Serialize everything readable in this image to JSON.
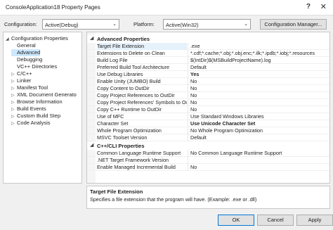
{
  "window": {
    "title": "ConsoleApplication18 Property Pages",
    "help_glyph": "?",
    "close_glyph": "✕"
  },
  "config_bar": {
    "configuration_label": "Configuration:",
    "configuration_value": "Active(Debug)",
    "platform_label": "Platform:",
    "platform_value": "Active(Win32)",
    "config_manager_label": "Configuration Manager..."
  },
  "tree": {
    "items": [
      {
        "label": "Configuration Properties",
        "arrow": "◢",
        "indent": 0,
        "selected": false
      },
      {
        "label": "General",
        "arrow": "",
        "indent": 1,
        "selected": false
      },
      {
        "label": "Advanced",
        "arrow": "",
        "indent": 1,
        "selected": true
      },
      {
        "label": "Debugging",
        "arrow": "",
        "indent": 1,
        "selected": false
      },
      {
        "label": "VC++ Directories",
        "arrow": "",
        "indent": 1,
        "selected": false
      },
      {
        "label": "C/C++",
        "arrow": "▷",
        "indent": 1,
        "selected": false
      },
      {
        "label": "Linker",
        "arrow": "▷",
        "indent": 1,
        "selected": false
      },
      {
        "label": "Manifest Tool",
        "arrow": "▷",
        "indent": 1,
        "selected": false
      },
      {
        "label": "XML Document Generato",
        "arrow": "▷",
        "indent": 1,
        "selected": false
      },
      {
        "label": "Browse Information",
        "arrow": "▷",
        "indent": 1,
        "selected": false
      },
      {
        "label": "Build Events",
        "arrow": "▷",
        "indent": 1,
        "selected": false
      },
      {
        "label": "Custom Build Step",
        "arrow": "▷",
        "indent": 1,
        "selected": false
      },
      {
        "label": "Code Analysis",
        "arrow": "▷",
        "indent": 1,
        "selected": false
      }
    ]
  },
  "grid": {
    "sections": [
      {
        "name": "Advanced Properties",
        "toggle": "◢",
        "rows": [
          {
            "name": "Target File Extension",
            "value": ".exe",
            "bold": false,
            "selected": true
          },
          {
            "name": "Extensions to Delete on Clean",
            "value": "*.cdf;*.cache;*.obj;*.obj.enc;*.ilk;*.ipdb;*.iobj;*.resources",
            "bold": false,
            "selected": false
          },
          {
            "name": "Build Log File",
            "value": "$(IntDir)$(MSBuildProjectName).log",
            "bold": false,
            "selected": false
          },
          {
            "name": "Preferred Build Tool Architecture",
            "value": "Default",
            "bold": false,
            "selected": false
          },
          {
            "name": "Use Debug Libraries",
            "value": "Yes",
            "bold": true,
            "selected": false
          },
          {
            "name": "Enable Unity (JUMBO) Build",
            "value": "No",
            "bold": false,
            "selected": false
          },
          {
            "name": "Copy Content to OutDir",
            "value": "No",
            "bold": false,
            "selected": false
          },
          {
            "name": "Copy Project References to OutDir",
            "value": "No",
            "bold": false,
            "selected": false
          },
          {
            "name": "Copy Project References' Symbols to Ou",
            "value": "No",
            "bold": false,
            "selected": false
          },
          {
            "name": "Copy C++ Runtime to OutDir",
            "value": "No",
            "bold": false,
            "selected": false
          },
          {
            "name": "Use of MFC",
            "value": "Use Standard Windows Libraries",
            "bold": false,
            "selected": false
          },
          {
            "name": "Character Set",
            "value": "Use Unicode Character Set",
            "bold": true,
            "selected": false
          },
          {
            "name": "Whole Program Optimization",
            "value": "No Whole Program Optimization",
            "bold": false,
            "selected": false
          },
          {
            "name": "MSVC Toolset Version",
            "value": "Default",
            "bold": false,
            "selected": false
          }
        ]
      },
      {
        "name": "C++/CLI Properties",
        "toggle": "◢",
        "rows": [
          {
            "name": "Common Language Runtime Support",
            "value": "No Common Language Runtime Support",
            "bold": false,
            "selected": false
          },
          {
            "name": ".NET Target Framework Version",
            "value": "",
            "bold": false,
            "selected": false
          },
          {
            "name": "Enable Managed Incremental Build",
            "value": "No",
            "bold": false,
            "selected": false
          }
        ]
      }
    ]
  },
  "description": {
    "title": "Target File Extension",
    "text": "Specifies a file extension that the program will have. (Example: .exe or .dll)"
  },
  "buttons": {
    "ok": "OK",
    "cancel": "Cancel",
    "apply": "Apply"
  }
}
